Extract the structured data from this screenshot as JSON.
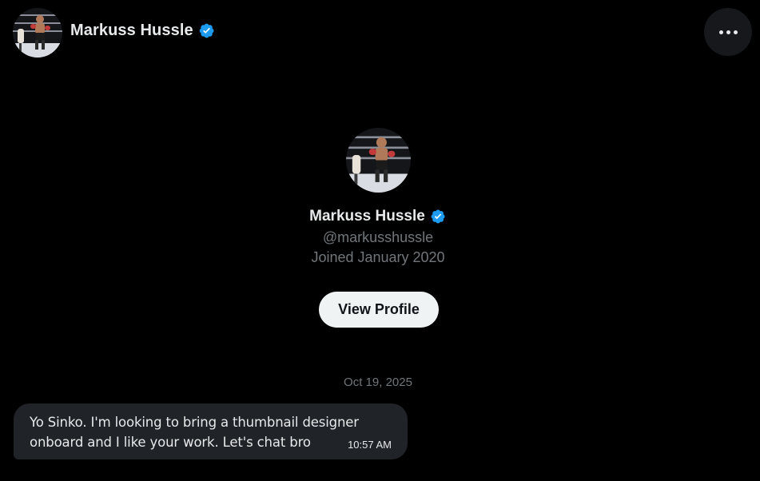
{
  "header": {
    "name": "Markuss Hussle",
    "avatar_icon": "boxer-avatar",
    "verified_icon": "verified-badge-icon",
    "more_icon": "more-horizontal-icon"
  },
  "profile": {
    "name": "Markuss Hussle",
    "handle": "@markusshussle",
    "joined": "Joined January 2020",
    "view_profile_label": "View Profile"
  },
  "conversation": {
    "date_separator": "Oct 19, 2025",
    "messages": [
      {
        "text": "Yo Sinko. I'm looking to bring a thumbnail designer onboard and I like your work. Let's chat bro",
        "time": "10:57 AM"
      }
    ]
  },
  "colors": {
    "background": "#000000",
    "verified": "#1d9bf0",
    "muted_text": "#71767b",
    "bubble": "#202327",
    "button_bg": "#eff3f4"
  }
}
